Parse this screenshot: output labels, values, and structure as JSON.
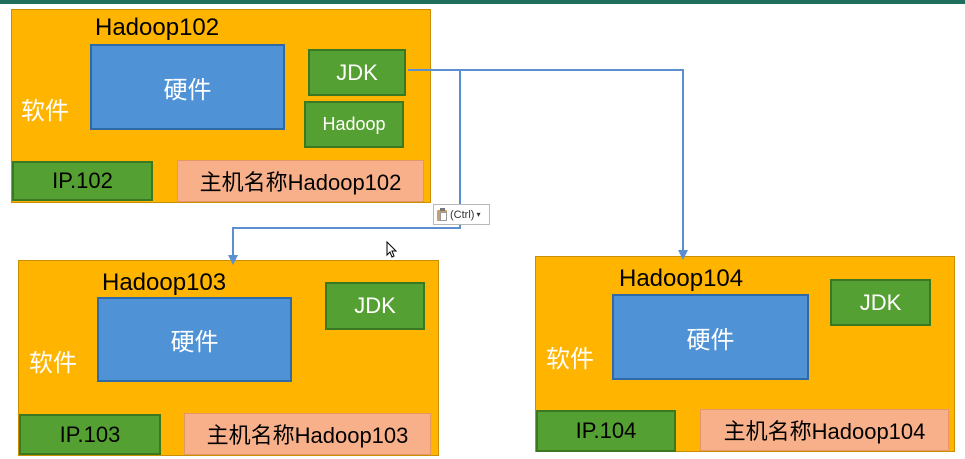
{
  "servers": [
    {
      "name": "Hadoop102",
      "software_label": "软件",
      "hardware_label": "硬件",
      "jdk_label": "JDK",
      "hadoop_label": "Hadoop",
      "ip_label": "IP.102",
      "hostname_label": "主机名称Hadoop102"
    },
    {
      "name": "Hadoop103",
      "software_label": "软件",
      "hardware_label": "硬件",
      "jdk_label": "JDK",
      "ip_label": "IP.103",
      "hostname_label": "主机名称Hadoop103"
    },
    {
      "name": "Hadoop104",
      "software_label": "软件",
      "hardware_label": "硬件",
      "jdk_label": "JDK",
      "ip_label": "IP.104",
      "hostname_label": "主机名称Hadoop104"
    }
  ],
  "paste_options": {
    "label": "(Ctrl)",
    "caret": "▾"
  },
  "colors": {
    "server_bg": "#ffb400",
    "hardware_bg": "#4f93d6",
    "software_box_bg": "#55a032",
    "hostname_bg": "#f8b08a",
    "arrow": "#5b8fd0",
    "top_bar": "#1f6f5c"
  }
}
